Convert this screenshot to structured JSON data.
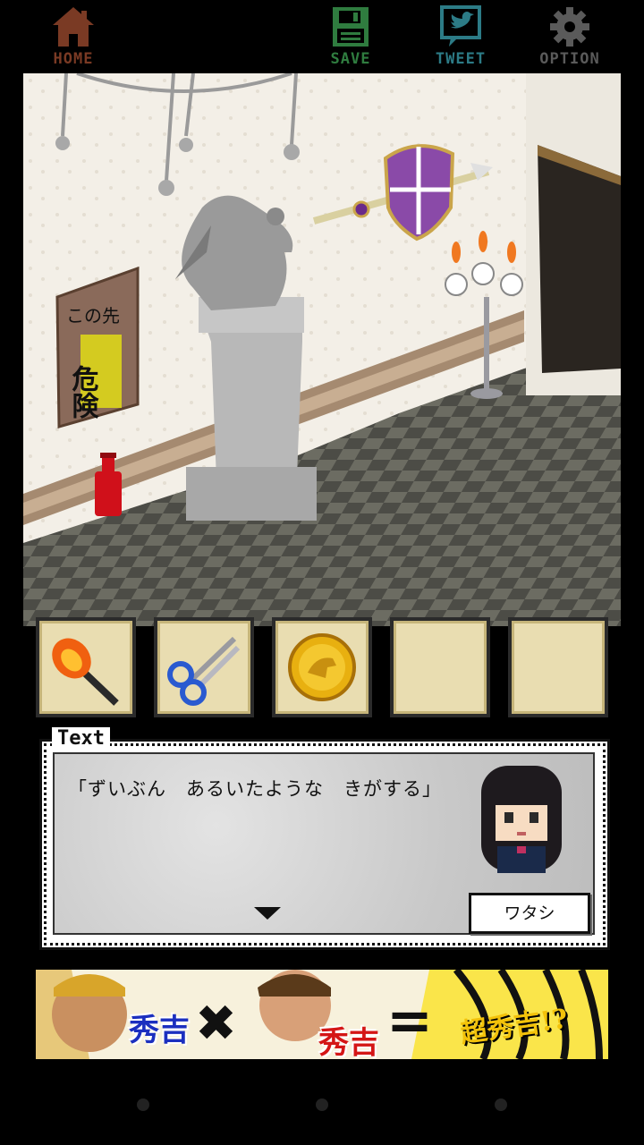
{
  "topbar": {
    "home_label": "HOME",
    "save_label": "SAVE",
    "tweet_label": "TWEET",
    "option_label": "OPTION"
  },
  "scene": {
    "poster_line1": "この先",
    "poster_line2": "危険"
  },
  "inventory": {
    "items": [
      {
        "icon": "torch-icon"
      },
      {
        "icon": "scissors-icon"
      },
      {
        "icon": "gold-coin-icon"
      },
      {
        "icon": ""
      },
      {
        "icon": ""
      }
    ]
  },
  "textbox": {
    "tab_label": "Text",
    "message": "「ずいぶん　あるいたような　きがする」",
    "speaker": "ワタシ"
  },
  "ad": {
    "text1": "秀吉",
    "times": "✖",
    "text2": "秀吉",
    "equals": "=",
    "text3": "超秀吉!?"
  },
  "colors": {
    "home": "#7a3a24",
    "save": "#2f7c3f",
    "tweet": "#2c7b86",
    "option": "#5a5a5a"
  }
}
